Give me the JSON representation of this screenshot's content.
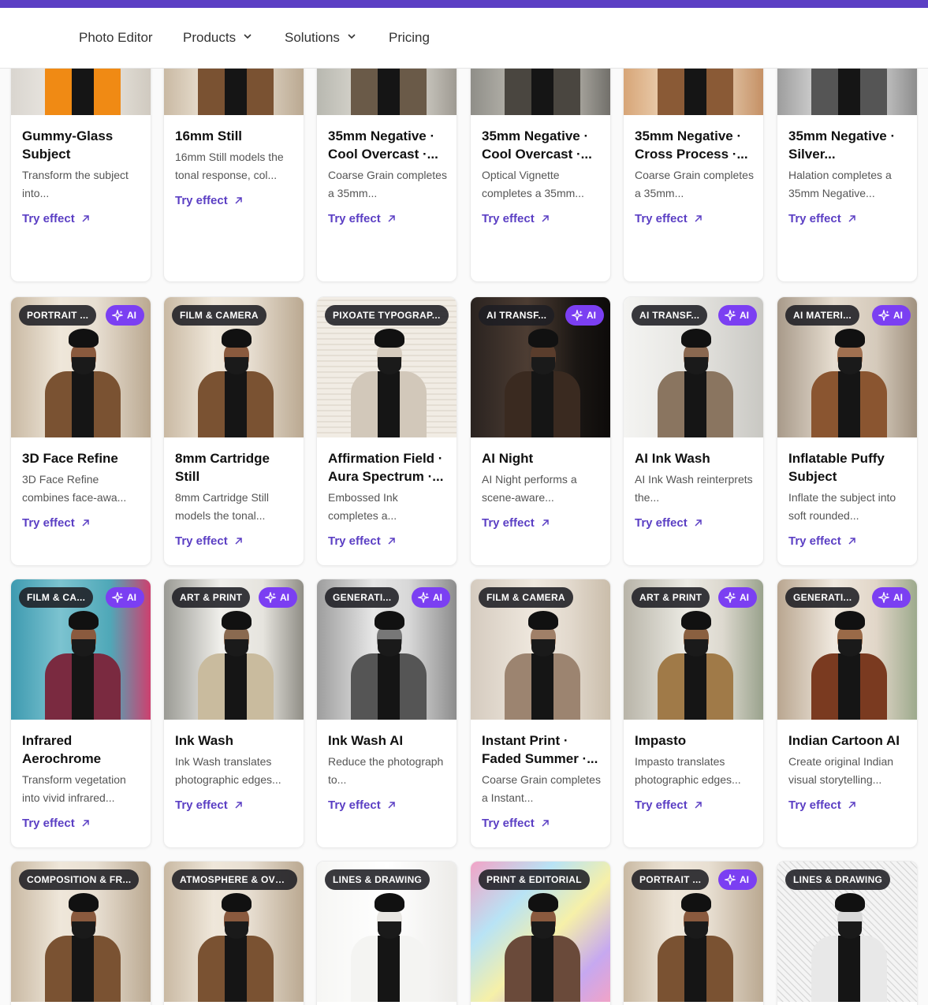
{
  "nav": {
    "items": [
      {
        "label": "Photo Editor",
        "dropdown": false
      },
      {
        "label": "Products",
        "dropdown": true
      },
      {
        "label": "Solutions",
        "dropdown": true
      },
      {
        "label": "Pricing",
        "dropdown": false
      }
    ]
  },
  "colors": {
    "accent": "#5b3fc4",
    "ai_badge": "#7b3ff2",
    "topbar": "#5b3fc4"
  },
  "try_label": "Try effect",
  "ai_label": "AI",
  "rows": [
    {
      "cards": [
        {
          "category": "",
          "ai": false,
          "title": "Gummy-Glass Subject",
          "desc": "Transform the subject into...",
          "style": "gummy"
        },
        {
          "category": "",
          "ai": false,
          "title": "16mm Still",
          "desc": "16mm Still models the tonal response, col...",
          "style": "warm"
        },
        {
          "category": "",
          "ai": false,
          "title": "35mm Negative · Cool Overcast ·...",
          "desc": "Coarse Grain completes a 35mm...",
          "style": "cool"
        },
        {
          "category": "",
          "ai": false,
          "title": "35mm Negative · Cool Overcast ·...",
          "desc": "Optical Vignette completes a 35mm...",
          "style": "dark"
        },
        {
          "category": "",
          "ai": false,
          "title": "35mm Negative · Cross Process ·...",
          "desc": "Coarse Grain completes a 35mm...",
          "style": "orange"
        },
        {
          "category": "",
          "ai": false,
          "title": "35mm Negative · Silver...",
          "desc": "Halation completes a 35mm Negative...",
          "style": "mono"
        }
      ]
    },
    {
      "cards": [
        {
          "category": "PORTRAIT ...",
          "ai": true,
          "title": "3D Face Refine",
          "desc": "3D Face Refine combines face-awa...",
          "style": "warm"
        },
        {
          "category": "FILM & CAMERA",
          "ai": false,
          "title": "8mm Cartridge Still",
          "desc": "8mm Cartridge Still models the tonal...",
          "style": "warm"
        },
        {
          "category": "PIXOATE TYPOGRAP...",
          "ai": false,
          "title": "Affirmation Field · Aura Spectrum ·...",
          "desc": "Embossed Ink completes a...",
          "style": "text"
        },
        {
          "category": "AI TRANSF...",
          "ai": true,
          "title": "AI Night",
          "desc": "AI Night performs a scene-aware...",
          "style": "night"
        },
        {
          "category": "AI TRANSF...",
          "ai": true,
          "title": "AI Ink Wash",
          "desc": "AI Ink Wash reinterprets the...",
          "style": "ink"
        },
        {
          "category": "AI MATERI...",
          "ai": true,
          "title": "Inflatable Puffy Subject",
          "desc": "Inflate the subject into soft rounded...",
          "style": "puffy"
        }
      ]
    },
    {
      "cards": [
        {
          "category": "FILM & CA...",
          "ai": true,
          "title": "Infrared Aerochrome",
          "desc": "Transform vegetation into vivid infrared...",
          "style": "infrared"
        },
        {
          "category": "ART & PRINT",
          "ai": true,
          "title": "Ink Wash",
          "desc": "Ink Wash translates photographic edges...",
          "style": "inkwash"
        },
        {
          "category": "GENERATI...",
          "ai": true,
          "title": "Ink Wash AI",
          "desc": "Reduce the photograph to...",
          "style": "mono"
        },
        {
          "category": "FILM & CAMERA",
          "ai": false,
          "title": "Instant Print · Faded Summer ·...",
          "desc": "Coarse Grain completes a Instant...",
          "style": "faded"
        },
        {
          "category": "ART & PRINT",
          "ai": true,
          "title": "Impasto",
          "desc": "Impasto translates photographic edges...",
          "style": "impasto"
        },
        {
          "category": "GENERATI...",
          "ai": true,
          "title": "Indian Cartoon AI",
          "desc": "Create original Indian visual storytelling...",
          "style": "cartoon"
        }
      ]
    },
    {
      "cards": [
        {
          "category": "COMPOSITION & FR...",
          "ai": false,
          "title": "",
          "desc": "",
          "style": "warm"
        },
        {
          "category": "ATMOSPHERE & OVE...",
          "ai": false,
          "title": "",
          "desc": "",
          "style": "warm"
        },
        {
          "category": "LINES & DRAWING",
          "ai": false,
          "title": "",
          "desc": "",
          "style": "sketch"
        },
        {
          "category": "PRINT & EDITORIAL",
          "ai": false,
          "title": "",
          "desc": "",
          "style": "holo"
        },
        {
          "category": "PORTRAIT ...",
          "ai": true,
          "title": "",
          "desc": "",
          "style": "warm"
        },
        {
          "category": "LINES & DRAWING",
          "ai": false,
          "title": "",
          "desc": "",
          "style": "hatch"
        }
      ]
    }
  ]
}
